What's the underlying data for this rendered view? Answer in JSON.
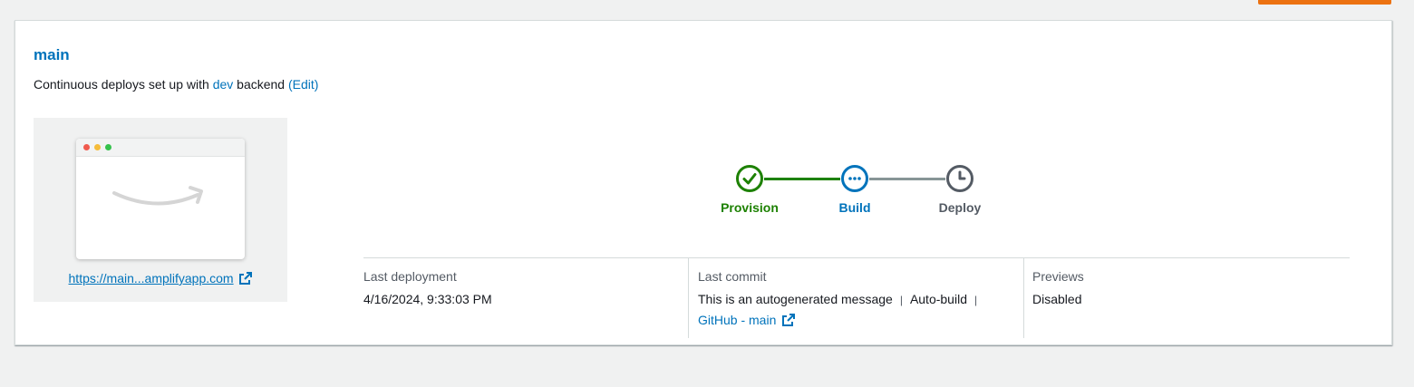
{
  "branch": {
    "name": "main",
    "subtitle_prefix": "Continuous deploys set up with",
    "backend_env": "dev",
    "subtitle_suffix": "backend",
    "edit_label": "(Edit)"
  },
  "preview": {
    "url_label": "https://main...amplifyapp.com"
  },
  "pipeline": {
    "steps": [
      {
        "label": "Provision",
        "status": "complete",
        "color": "#1d8102",
        "icon": "check-circle-icon"
      },
      {
        "label": "Build",
        "status": "in-progress",
        "color": "#0073bb",
        "icon": "ellipsis-circle-icon"
      },
      {
        "label": "Deploy",
        "status": "pending",
        "color": "#545b64",
        "icon": "clock-circle-icon"
      }
    ]
  },
  "details": {
    "last_deployment": {
      "label": "Last deployment",
      "value": "4/16/2024, 9:33:03 PM"
    },
    "last_commit": {
      "label": "Last commit",
      "message": "This is an autogenerated message",
      "separator": "|",
      "trigger": "Auto-build",
      "repo_link": "GitHub - main"
    },
    "previews": {
      "label": "Previews",
      "value": "Disabled"
    }
  },
  "colors": {
    "accent": "#ec7211",
    "link": "#0073bb",
    "success": "#1d8102",
    "pending": "#545b64"
  }
}
